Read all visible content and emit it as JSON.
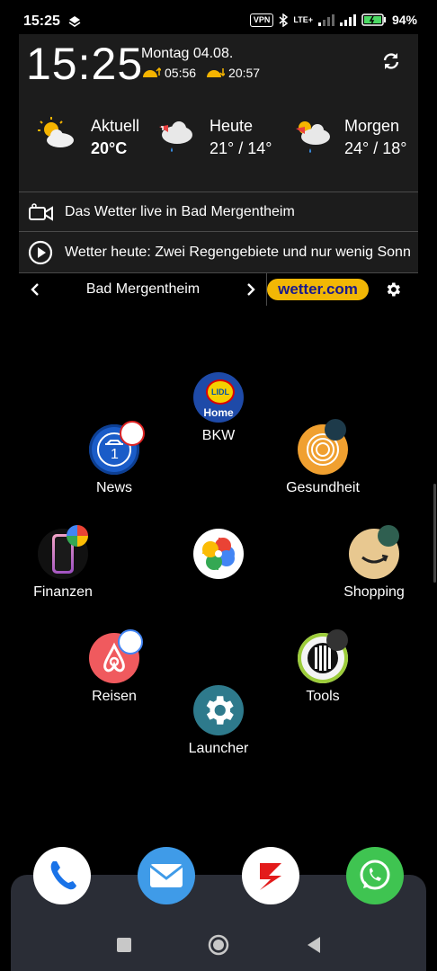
{
  "status_bar": {
    "time": "15:25",
    "vpn": "VPN",
    "network": "LTE+",
    "battery": "94%"
  },
  "widget": {
    "clock": "15:25",
    "date": "Montag 04.08.",
    "sunrise": "05:56",
    "sunset": "20:57",
    "forecast": [
      {
        "label": "Aktuell",
        "value": "20°C",
        "icon": "sun-cloud-icon"
      },
      {
        "label": "Heute",
        "value": "21° / 14°",
        "icon": "windy-rain-icon"
      },
      {
        "label": "Morgen",
        "value": "24° / 18°",
        "icon": "sun-windy-rain-icon"
      }
    ],
    "live_text": "Das Wetter live in Bad Mergentheim",
    "news_text": "Wetter heute: Zwei Regengebiete und nur wenig Sonn...",
    "location": "Bad Mergentheim",
    "brand": "wetter.com"
  },
  "apps": {
    "bkw": "BKW",
    "bkw_icon_text": "Home",
    "lidl_text": "LIDL",
    "news": "News",
    "gesundheit": "Gesundheit",
    "finanzen": "Finanzen",
    "shopping": "Shopping",
    "reisen": "Reisen",
    "tools": "Tools",
    "launcher": "Launcher"
  },
  "dock": [
    "phone-icon",
    "mail-icon",
    "s-app-icon",
    "whatsapp-icon"
  ],
  "colors": {
    "widget_bg": "#1c1c1c",
    "brand_yellow": "#f2b705",
    "dock_bg": "#2a2d36"
  }
}
